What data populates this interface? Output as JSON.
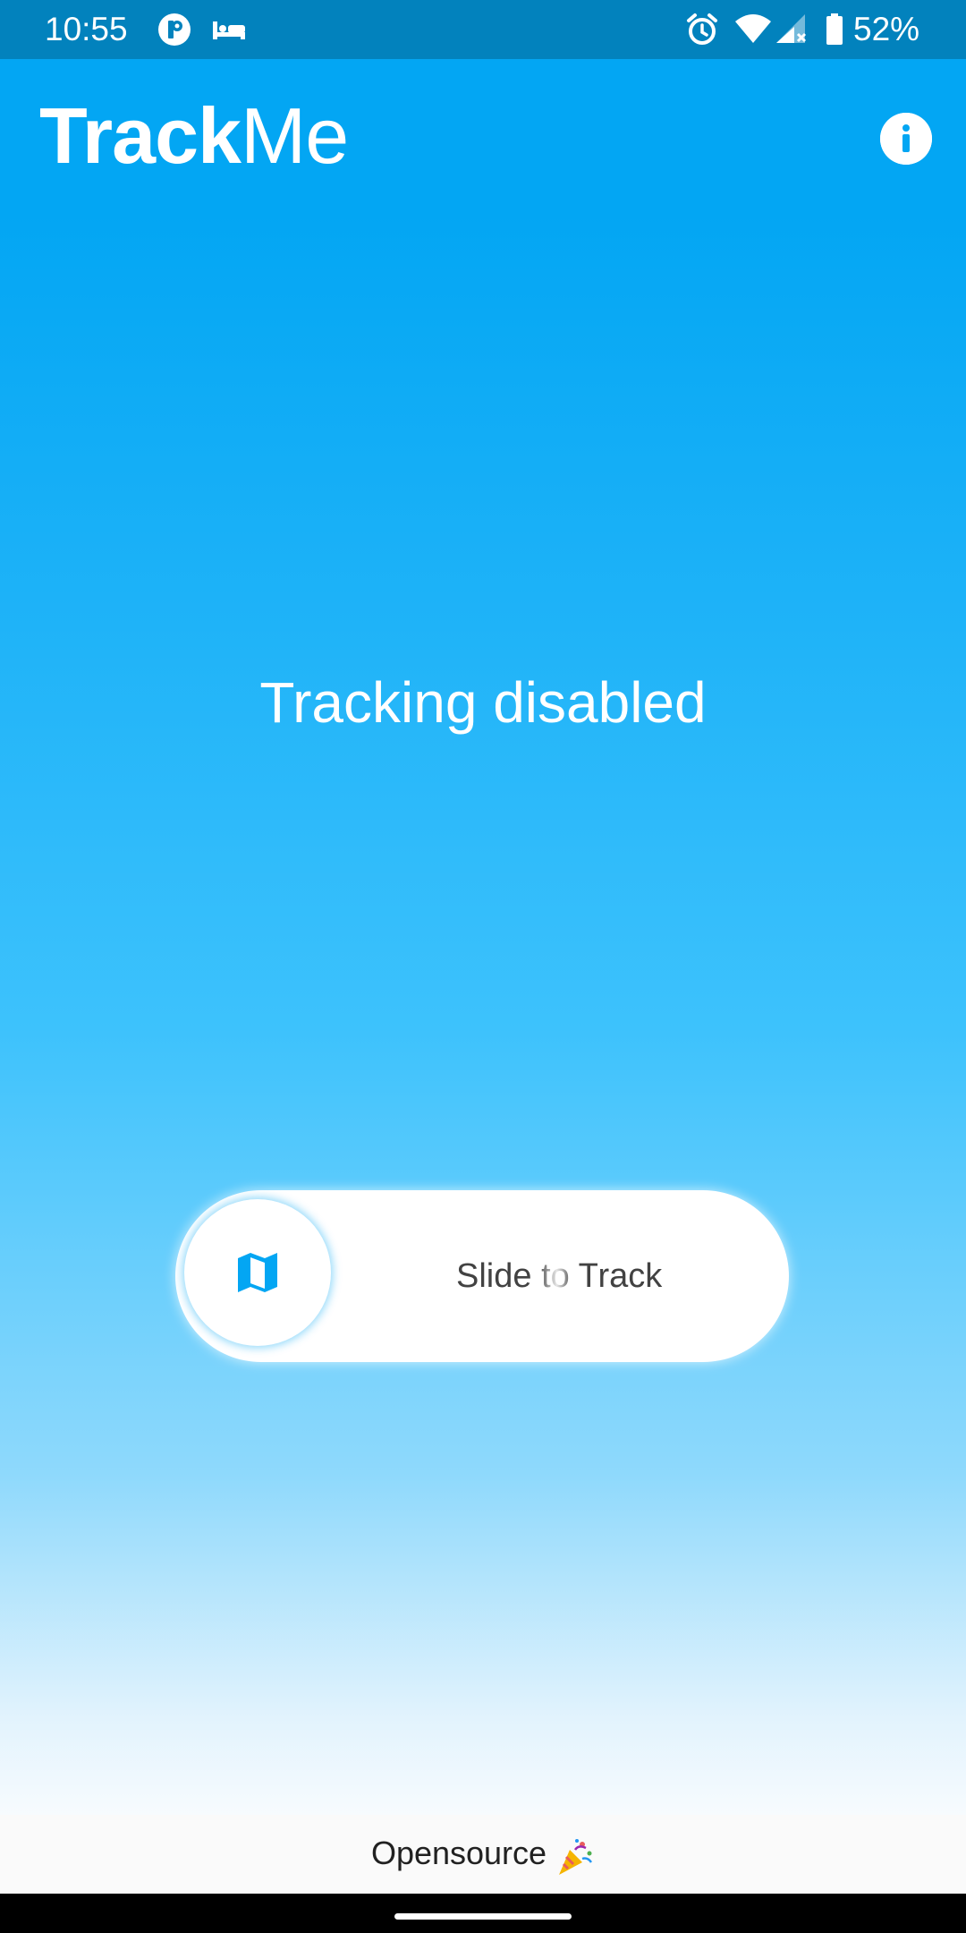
{
  "status_bar": {
    "time": "10:55",
    "battery_percent": "52%",
    "icons": [
      "app-notification-icon",
      "bed-icon",
      "alarm-icon",
      "wifi-icon",
      "signal-icon",
      "battery-icon"
    ]
  },
  "app_bar": {
    "title_bold": "Track",
    "title_light": "Me",
    "info_icon": "info-icon"
  },
  "main": {
    "status_text": "Tracking disabled"
  },
  "slider": {
    "label_start": "Slid",
    "label_shimmer": "e to T",
    "label_end": "rack",
    "knob_icon": "map-icon",
    "position": 0
  },
  "footer": {
    "text": "Opensource",
    "emoji_icon": "party-popper-icon"
  },
  "colors": {
    "accent": "#03a6f3",
    "status_bar": "#0282bd",
    "text_dark": "#424242",
    "footer_bg": "#fafafa"
  }
}
